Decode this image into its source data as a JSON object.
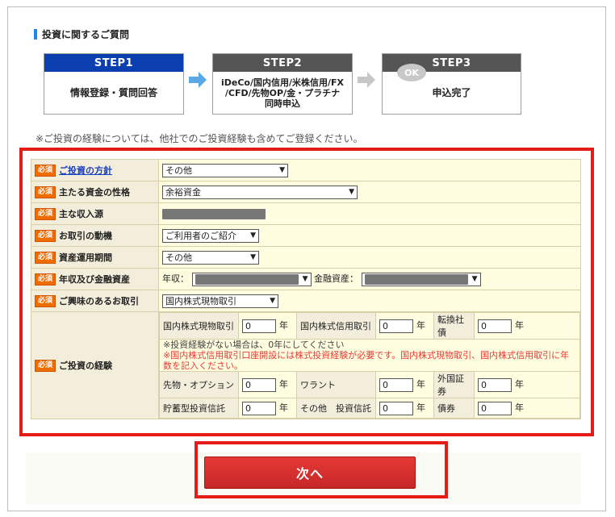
{
  "section_title": "投資に関するご質問",
  "steps": [
    {
      "head": "STEP1",
      "body": "情報登録・質問回答"
    },
    {
      "head": "STEP2",
      "body": "iDeCo/国内信用/米株信用/FX\n/CFD/先物OP/金・プラチナ\n同時申込"
    },
    {
      "head": "STEP3",
      "body": "申込完了",
      "badge": "OK"
    }
  ],
  "note": "※ご投資の経験については、他社でのご投資経験も含めてご登録ください。",
  "required_label": "必須",
  "form": {
    "policy": {
      "label": "ご投資の方針",
      "value": "その他"
    },
    "funds": {
      "label": "主たる資金の性格",
      "value": "余裕資金"
    },
    "income_source": {
      "label": "主な収入源"
    },
    "motive": {
      "label": "お取引の動機",
      "value": "ご利用者のご紹介"
    },
    "period": {
      "label": "資産運用期間",
      "value": "その他"
    },
    "income": {
      "label": "年収及び金融資産",
      "annual_label": "年収：",
      "assets_label": "金融資産："
    },
    "interest": {
      "label": "ご興味のあるお取引",
      "value": "国内株式現物取引"
    },
    "experience": {
      "label": "ご投資の経験",
      "year_unit": "年",
      "row1": [
        {
          "name": "国内株式現物取引",
          "value": "0"
        },
        {
          "name": "国内株式信用取引",
          "value": "0"
        },
        {
          "name": "転換社債",
          "value": "0"
        }
      ],
      "note1": "※投資経験がない場合は、0年にしてください",
      "note2": "※国内株式信用取引口座開設には株式投資経験が必要です。国内株式現物取引、国内株式信用取引に年数を記入ください。",
      "row2": [
        {
          "name": "先物・オプション",
          "value": "0"
        },
        {
          "name": "ワラント",
          "value": "0"
        },
        {
          "name": "外国証券",
          "value": "0"
        }
      ],
      "row3": [
        {
          "name": "貯蓄型投資信託",
          "value": "0"
        },
        {
          "name": "その他　投資信託",
          "value": "0"
        },
        {
          "name": "債券",
          "value": "0"
        }
      ]
    }
  },
  "next_button": "次へ",
  "colors": {
    "step_active": "#0b3fb0",
    "highlight": "#e41b17",
    "required": "#ef6c00",
    "button": "#d32f2f"
  }
}
